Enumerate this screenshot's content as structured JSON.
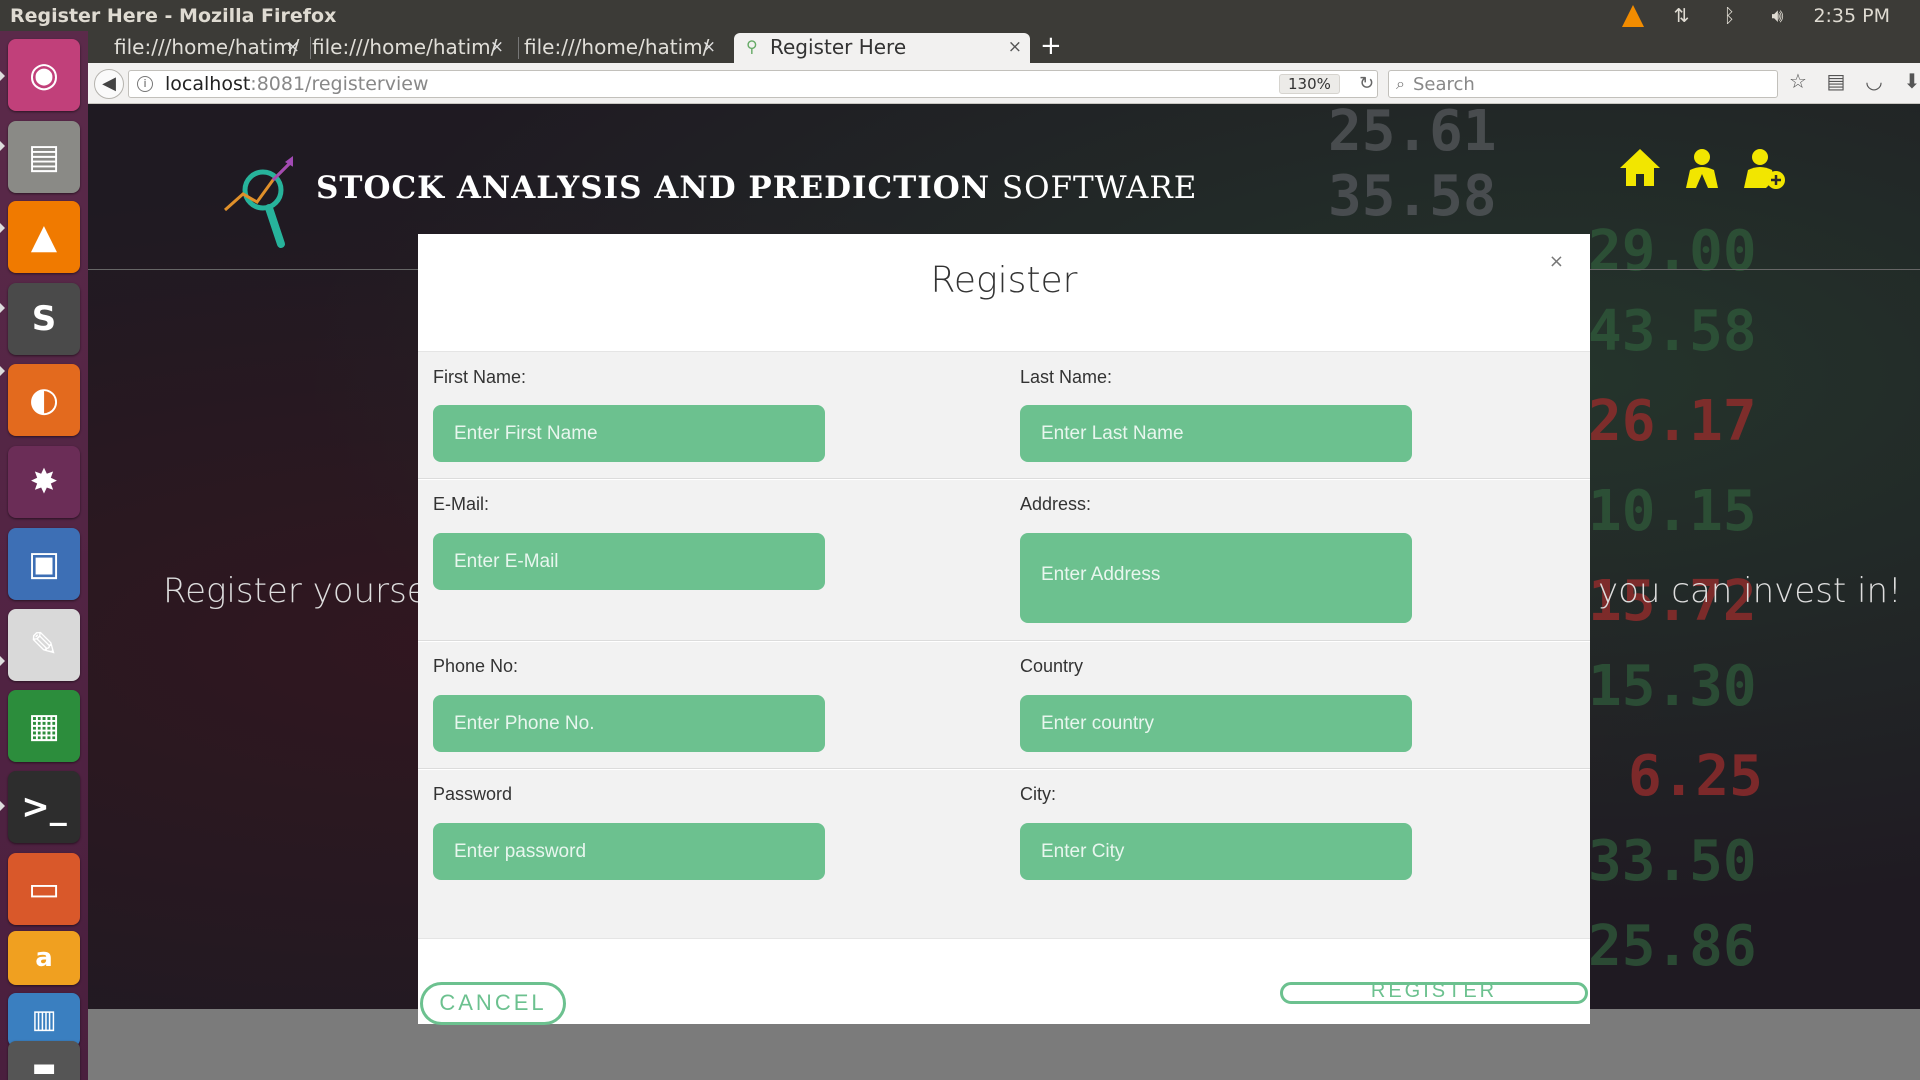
{
  "window": {
    "title": "Register Here - Mozilla Firefox"
  },
  "tray": {
    "time": "2:35 PM",
    "vlc_icon": "vlc-cone-icon",
    "network_icon": "network-updown-icon",
    "bluetooth_icon": "bluetooth-icon",
    "volume_icon": "volume-icon"
  },
  "launcher": {
    "items": [
      {
        "name": "ubuntu-dash-icon",
        "glyph": "◉",
        "bg": "#c1407a"
      },
      {
        "name": "files-icon",
        "glyph": "▤",
        "bg": "#8a8a86"
      },
      {
        "name": "vlc-icon",
        "glyph": "▲",
        "bg": "#f07a00"
      },
      {
        "name": "sublime-text-icon",
        "glyph": "S",
        "bg": "#4a4a4a"
      },
      {
        "name": "firefox-icon",
        "glyph": "◐",
        "bg": "#e36a1e"
      },
      {
        "name": "network-app-icon",
        "glyph": "✸",
        "bg": "#6b2d57"
      },
      {
        "name": "image-viewer-icon",
        "glyph": "▣",
        "bg": "#3d6fb5"
      },
      {
        "name": "text-editor-icon",
        "glyph": "✎",
        "bg": "#d9d9d9"
      },
      {
        "name": "spreadsheet-icon",
        "glyph": "▦",
        "bg": "#2c8d3c"
      },
      {
        "name": "terminal-icon",
        "glyph": ">_",
        "bg": "#2d2d2d"
      },
      {
        "name": "presentation-icon",
        "glyph": "▭",
        "bg": "#d9582a"
      },
      {
        "name": "amazon-icon",
        "glyph": "a",
        "bg": "#f0a020"
      },
      {
        "name": "workspace-switcher-icon",
        "glyph": "▥",
        "bg": "#3a7fc0"
      },
      {
        "name": "removable-drive-icon",
        "glyph": "▬",
        "bg": "#555"
      }
    ]
  },
  "tabs": [
    {
      "label": "file:///home/hatim/",
      "close": "×"
    },
    {
      "label": "file:///home/hatim/",
      "close": "×"
    },
    {
      "label": "file:///home/hatim/",
      "close": "×"
    },
    {
      "label": "Register Here",
      "close": "×"
    }
  ],
  "newtab": "+",
  "navbar": {
    "url_host": "localhost",
    "url_rest": ":8081/registerview",
    "zoom": "130%",
    "search_placeholder": "Search"
  },
  "page": {
    "title_bold": "STOCK ANALYSIS AND PREDICTION",
    "title_light": "SOFTWARE",
    "tagline_left": "Register yourself t",
    "tagline_right": "you can invest in!",
    "bg_numbers": [
      "25.61",
      "35.58",
      "29.00",
      "43.58",
      "26.17",
      "10.15",
      "15.72",
      "15.30",
      "6.25",
      "33.50",
      "25.86"
    ],
    "header_icons": [
      "home-icon",
      "user-icon",
      "add-user-icon"
    ],
    "accent": "#f2e600"
  },
  "modal": {
    "title": "Register",
    "close": "×",
    "fields": {
      "first_name": {
        "label": "First Name:",
        "placeholder": "Enter First Name"
      },
      "last_name": {
        "label": "Last Name:",
        "placeholder": "Enter Last Name"
      },
      "email": {
        "label": "E-Mail:",
        "placeholder": "Enter E-Mail"
      },
      "address": {
        "label": "Address:",
        "placeholder": "Enter Address"
      },
      "phone": {
        "label": "Phone No:",
        "placeholder": "Enter Phone No."
      },
      "country": {
        "label": "Country",
        "placeholder": "Enter country"
      },
      "password": {
        "label": "Password",
        "placeholder": "Enter password"
      },
      "city": {
        "label": "City:",
        "placeholder": "Enter City"
      }
    },
    "cancel": "CANCEL",
    "register": "REGISTER",
    "accent": "#6cc18f"
  }
}
